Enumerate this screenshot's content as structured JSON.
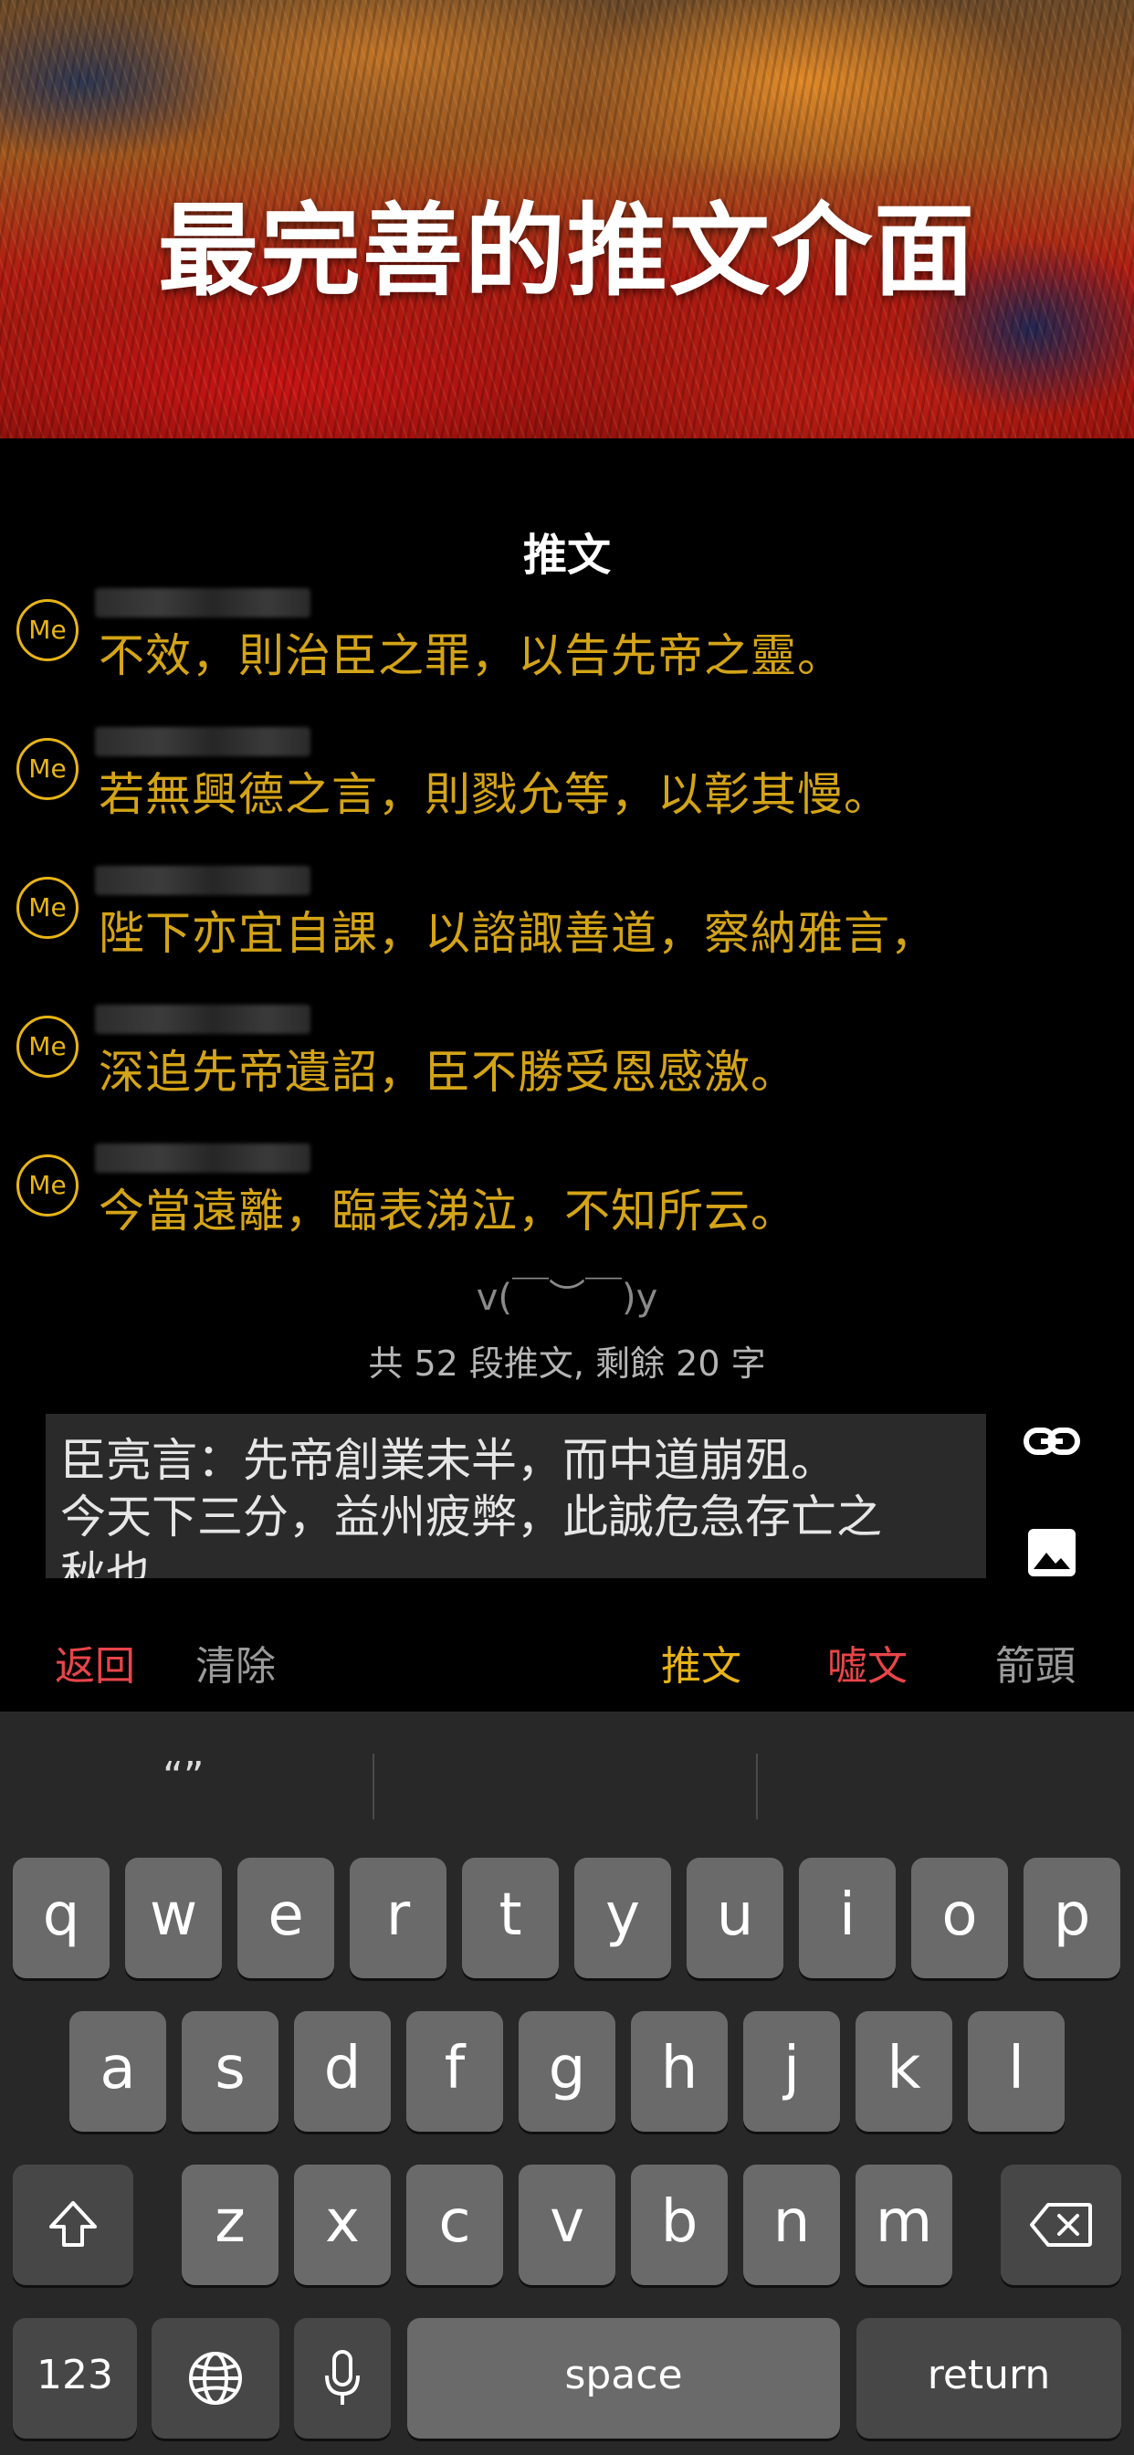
{
  "hero": {
    "title": "最完善的推文介面"
  },
  "sheet": {
    "title": "推文"
  },
  "thread": {
    "avatar_label": "Me",
    "tweets": [
      {
        "text": "不效，則治臣之罪，以告先帝之靈。"
      },
      {
        "text": "若無興德之言，則戮允等，以彰其慢。"
      },
      {
        "text": "陛下亦宜自課，以諮諏善道，察納雅言，"
      },
      {
        "text": "深追先帝遺詔，臣不勝受恩感激。"
      },
      {
        "text": "今當遠離，臨表涕泣，不知所云。"
      }
    ]
  },
  "emoticon": "v(￣︶￣)y",
  "counter": "共 52 段推文, 剩餘 20 字",
  "compose": {
    "line1": "臣亮言：先帝創業未半，而中道崩殂。",
    "line2": "今天下三分，益州疲弊，此誠危急存亡之",
    "line3": "秋也。"
  },
  "icons": {
    "link": "link-icon",
    "image": "image-icon"
  },
  "actions": {
    "back": "返回",
    "clear": "清除",
    "tweet": "推文",
    "sigh": "嘘文",
    "arrow": "箭頭"
  },
  "colors": {
    "accent_gold": "#e8b416",
    "accent_red": "#e8454a",
    "muted": "#9a9a9a"
  },
  "keyboard": {
    "suggestion": "“”",
    "row1": [
      "q",
      "w",
      "e",
      "r",
      "t",
      "y",
      "u",
      "i",
      "o",
      "p"
    ],
    "row2": [
      "a",
      "s",
      "d",
      "f",
      "g",
      "h",
      "j",
      "k",
      "l"
    ],
    "row3": [
      "z",
      "x",
      "c",
      "v",
      "b",
      "n",
      "m"
    ],
    "numbers_key": "123",
    "space_key": "space",
    "return_key": "return"
  }
}
